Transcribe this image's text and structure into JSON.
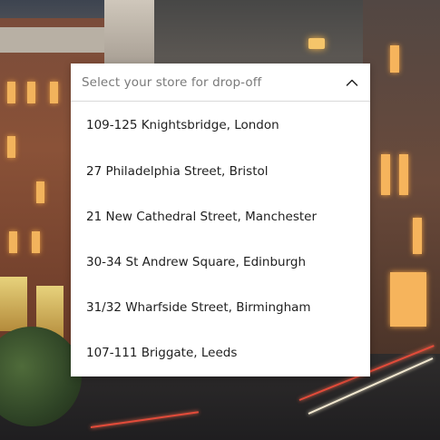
{
  "store_dropdown": {
    "placeholder": "Select your store for drop-off",
    "toggle_icon": "chevron-up-icon",
    "options": [
      {
        "label": "109-125 Knightsbridge, London"
      },
      {
        "label": "27 Philadelphia Street, Bristol"
      },
      {
        "label": "21 New Cathedral Street, Manchester"
      },
      {
        "label": "30-34 St Andrew Square, Edinburgh"
      },
      {
        "label": "31/32 Wharfside Street, Birmingham"
      },
      {
        "label": "107-111 Briggate, Leeds"
      }
    ]
  },
  "colors": {
    "panel_background": "#ffffff",
    "placeholder_text": "#7a7a7a",
    "option_text": "#1f1f1f",
    "divider": "#d9d9d9"
  }
}
